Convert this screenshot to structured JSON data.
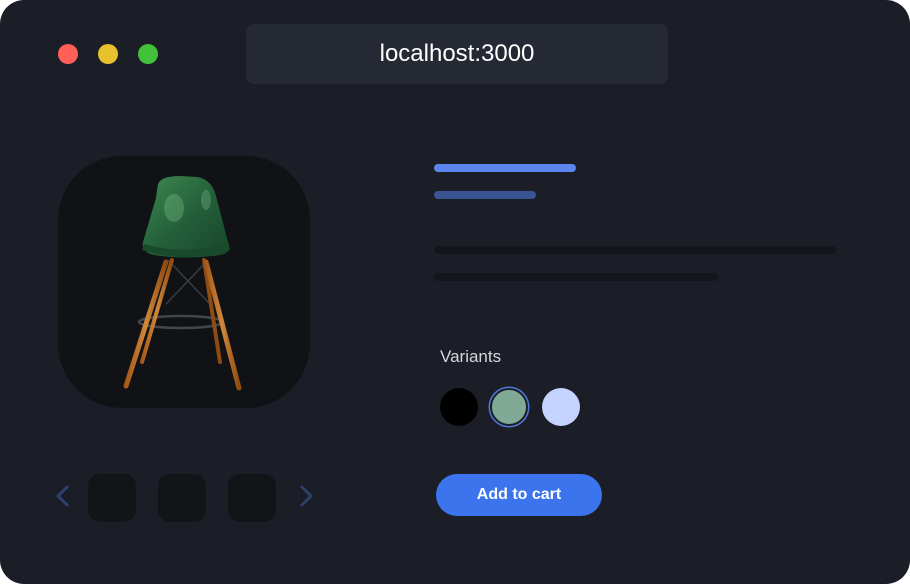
{
  "browser": {
    "url": "localhost:3000",
    "traffic_lights": [
      "#ff5f57",
      "#e8c22e",
      "#43c13a"
    ]
  },
  "product": {
    "image_icon": "green-stool-chair",
    "skeleton_colors": {
      "title": "#5b86ee",
      "subtitle": "#3a5493"
    }
  },
  "gallery": {
    "arrow_color": "#2d4170"
  },
  "variants": {
    "label": "Variants",
    "swatches": [
      "#000000",
      "#81aa96",
      "#c4d4ff"
    ],
    "selected": 1
  },
  "cart": {
    "button_label": "Add to cart"
  }
}
